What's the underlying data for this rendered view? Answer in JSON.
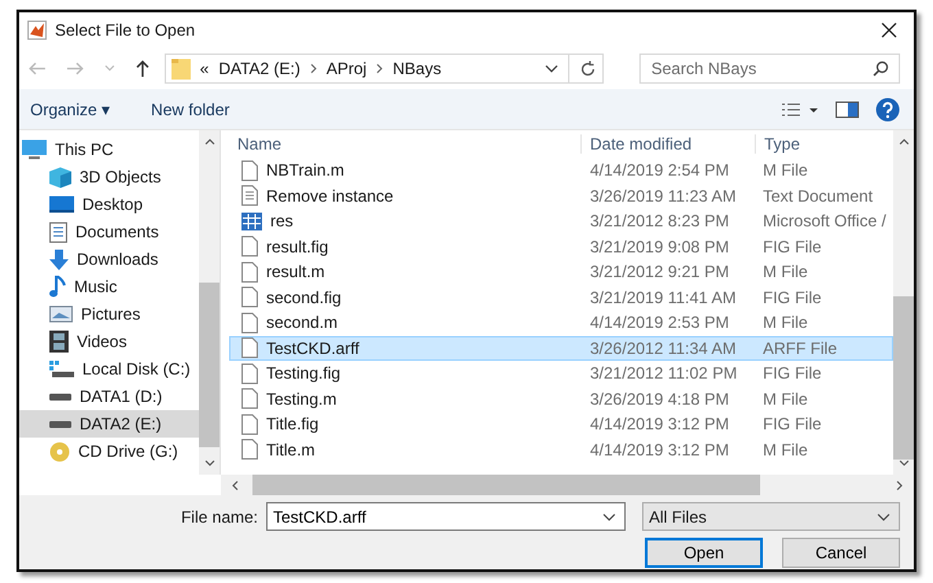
{
  "window": {
    "title": "Select File to Open"
  },
  "address": {
    "crumbs": [
      "«",
      "DATA2 (E:)",
      "AProj",
      "NBays"
    ]
  },
  "search": {
    "placeholder": "Search NBays"
  },
  "toolbar": {
    "organize": "Organize ▾",
    "new_folder": "New folder"
  },
  "sidebar": {
    "items": [
      {
        "label": "This PC",
        "kind": "pc",
        "selected": false
      },
      {
        "label": "3D Objects",
        "kind": "cube",
        "selected": false
      },
      {
        "label": "Desktop",
        "kind": "desktop",
        "selected": false
      },
      {
        "label": "Documents",
        "kind": "documents",
        "selected": false
      },
      {
        "label": "Downloads",
        "kind": "downloads",
        "selected": false
      },
      {
        "label": "Music",
        "kind": "music",
        "selected": false
      },
      {
        "label": "Pictures",
        "kind": "pictures",
        "selected": false
      },
      {
        "label": "Videos",
        "kind": "videos",
        "selected": false
      },
      {
        "label": "Local Disk (C:)",
        "kind": "system-drive",
        "selected": false
      },
      {
        "label": "DATA1 (D:)",
        "kind": "drive",
        "selected": false
      },
      {
        "label": "DATA2 (E:)",
        "kind": "drive",
        "selected": true
      },
      {
        "label": "CD Drive (G:)",
        "kind": "cd",
        "selected": false
      }
    ]
  },
  "table": {
    "columns": [
      "Name",
      "Date modified",
      "Type"
    ],
    "rows": [
      {
        "name": "NBTrain.m",
        "date": "4/14/2019 2:54 PM",
        "type": "M File",
        "kind": "file",
        "selected": false
      },
      {
        "name": "Remove instance",
        "date": "3/26/2019 11:23 AM",
        "type": "Text Document",
        "kind": "text",
        "selected": false
      },
      {
        "name": "res",
        "date": "3/21/2012 8:23 PM",
        "type": "Microsoft Office /",
        "kind": "sheet",
        "selected": false
      },
      {
        "name": "result.fig",
        "date": "3/21/2019 9:08 PM",
        "type": "FIG File",
        "kind": "file",
        "selected": false
      },
      {
        "name": "result.m",
        "date": "3/21/2012 9:21 PM",
        "type": "M File",
        "kind": "file",
        "selected": false
      },
      {
        "name": "second.fig",
        "date": "3/21/2019 11:41 AM",
        "type": "FIG File",
        "kind": "file",
        "selected": false
      },
      {
        "name": "second.m",
        "date": "4/14/2019 2:53 PM",
        "type": "M File",
        "kind": "file",
        "selected": false
      },
      {
        "name": "TestCKD.arff",
        "date": "3/26/2012 11:34 AM",
        "type": "ARFF File",
        "kind": "file",
        "selected": true
      },
      {
        "name": "Testing.fig",
        "date": "3/21/2012 11:02 PM",
        "type": "FIG File",
        "kind": "file",
        "selected": false
      },
      {
        "name": "Testing.m",
        "date": "3/26/2019 4:18 PM",
        "type": "M File",
        "kind": "file",
        "selected": false
      },
      {
        "name": "Title.fig",
        "date": "4/14/2019 3:12 PM",
        "type": "FIG File",
        "kind": "file",
        "selected": false
      },
      {
        "name": "Title.m",
        "date": "4/14/2019 3:12 PM",
        "type": "M File",
        "kind": "file",
        "selected": false
      }
    ]
  },
  "file_name": {
    "label": "File name:",
    "value": "TestCKD.arff"
  },
  "filter": {
    "value": "All Files"
  },
  "buttons": {
    "open": "Open",
    "cancel": "Cancel"
  }
}
